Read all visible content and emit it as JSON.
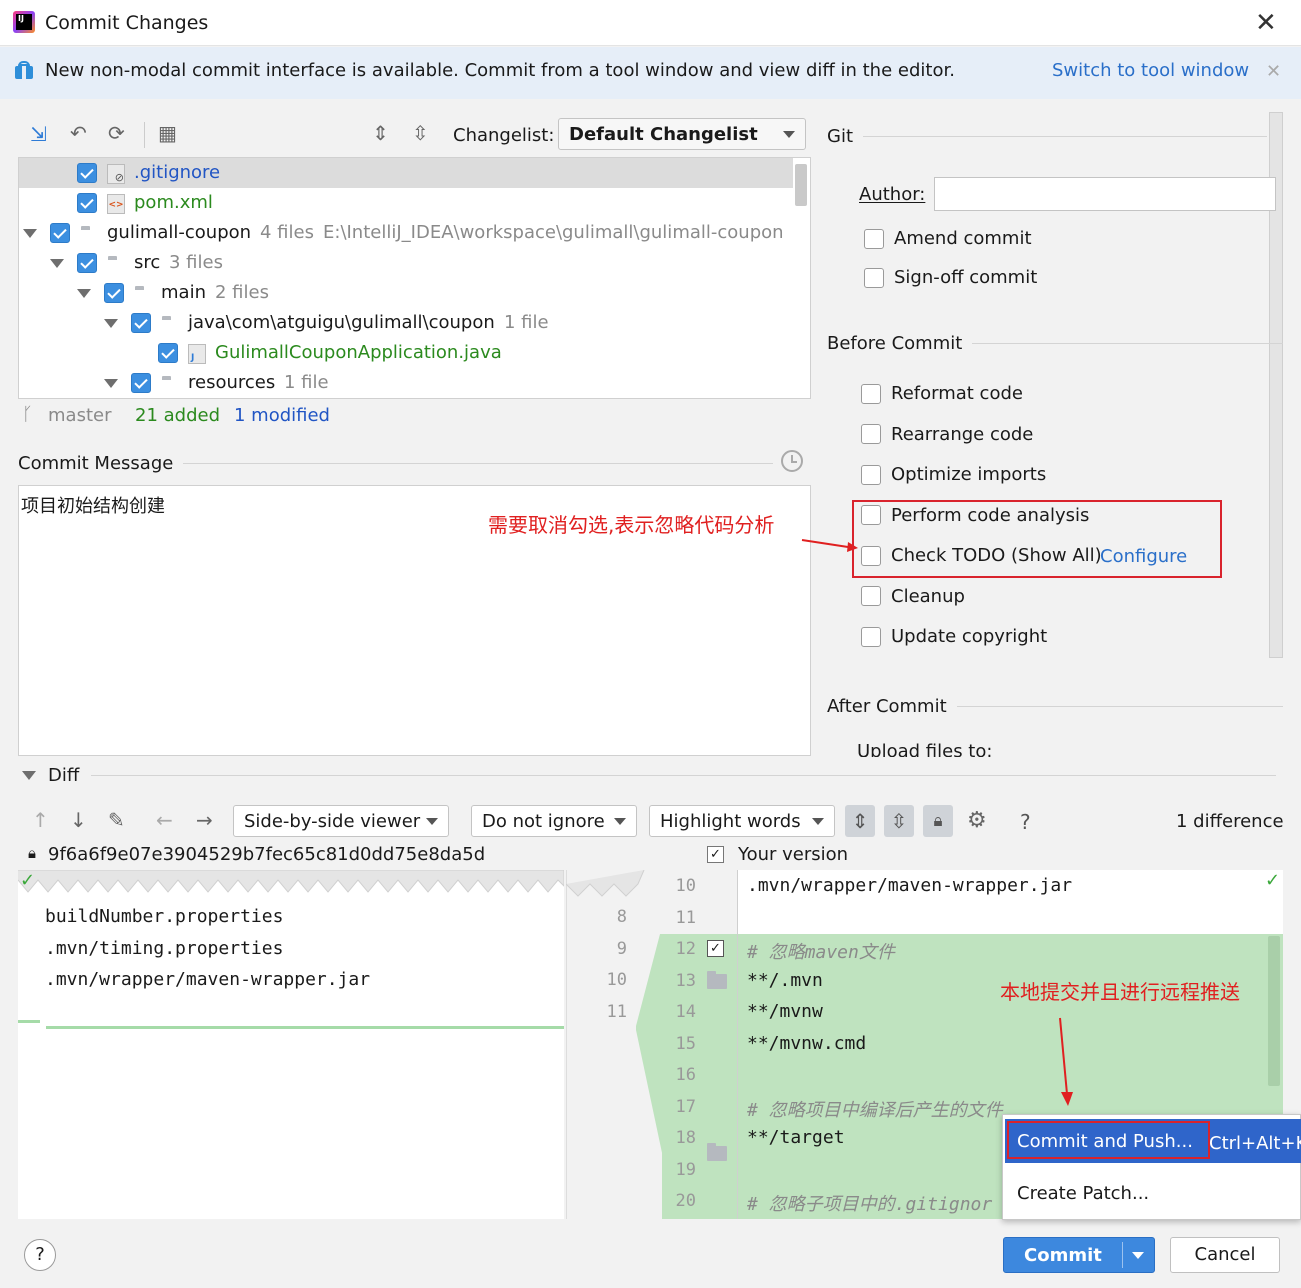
{
  "window": {
    "title": "Commit Changes",
    "close_icon": "close-icon"
  },
  "banner": {
    "text": "New non-modal commit interface is available. Commit from a tool window and view diff in the editor.",
    "link": "Switch to tool window"
  },
  "toolbar": {
    "changelist_label": "Changelist:",
    "changelist_value": "Default Changelist"
  },
  "tree": [
    {
      "label": ".gitignore",
      "extra": "",
      "path": "",
      "color": "#2155c4"
    },
    {
      "label": "pom.xml",
      "extra": "",
      "path": "",
      "color": "#2b8a1e"
    },
    {
      "label": "gulimall-coupon",
      "extra": "4 files",
      "path": "E:\\IntelliJ_IDEA\\workspace\\gulimall\\gulimall-coupon",
      "color": "#1a1a1a"
    },
    {
      "label": "src",
      "extra": "3 files",
      "path": "",
      "color": "#1a1a1a"
    },
    {
      "label": "main",
      "extra": "2 files",
      "path": "",
      "color": "#1a1a1a"
    },
    {
      "label": "java\\com\\atguigu\\gulimall\\coupon",
      "extra": "1 file",
      "path": "",
      "color": "#1a1a1a"
    },
    {
      "label": "GulimallCouponApplication.java",
      "extra": "",
      "path": "",
      "color": "#2b8a1e"
    },
    {
      "label": "resources",
      "extra": "1 file",
      "path": "",
      "color": "#1a1a1a"
    }
  ],
  "status": {
    "branch": "master",
    "added": "21 added",
    "modified": "1 modified"
  },
  "commit_message": {
    "label": "Commit Message",
    "text": "项目初始结构创建"
  },
  "annotations": {
    "uncheck_note": "需要取消勾选,表示忽略代码分析",
    "push_note": "本地提交并且进行远程推送"
  },
  "git": {
    "section": "Git",
    "author_label": "Author:",
    "author_value": "",
    "amend": "Amend commit",
    "signoff": "Sign-off commit",
    "before_commit": "Before Commit",
    "options": [
      "Reformat code",
      "Rearrange code",
      "Optimize imports",
      "Perform code analysis",
      "Check TODO (Show All)",
      "Cleanup",
      "Update copyright"
    ],
    "configure": "Configure",
    "after_commit": "After Commit",
    "upload": "Upload files to:"
  },
  "diff": {
    "label": "Diff",
    "viewer": "Side-by-side viewer",
    "ignore": "Do not ignore",
    "highlight": "Highlight words",
    "help": "?",
    "count": "1 difference",
    "left_title": "9f6a6f9e07e3904529b7fec65c81d0dd75e8da5d",
    "right_title": "Your version",
    "left_lines": [
      "buildNumber.properties",
      ".mvn/timing.properties",
      ".mvn/wrapper/maven-wrapper.jar"
    ],
    "left_nums": [
      "8",
      "9",
      "10",
      "11"
    ],
    "right_nums": [
      "10",
      "11",
      "12",
      "13",
      "14",
      "15",
      "16",
      "17",
      "18",
      "19",
      "20"
    ],
    "right_lines": [
      ".mvn/wrapper/maven-wrapper.jar",
      "",
      "#  忽略maven文件",
      "**/.mvn",
      "**/mvnw",
      "**/mvnw.cmd",
      "",
      "#  忽略项目中编译后产生的文件",
      "**/target",
      "",
      "#  忽略子项目中的.gitignor"
    ]
  },
  "popup": {
    "commit_push": "Commit and Push...",
    "shortcut": "Ctrl+Alt+K",
    "create_patch": "Create Patch..."
  },
  "buttons": {
    "commit": "Commit",
    "cancel": "Cancel",
    "help": "?"
  }
}
